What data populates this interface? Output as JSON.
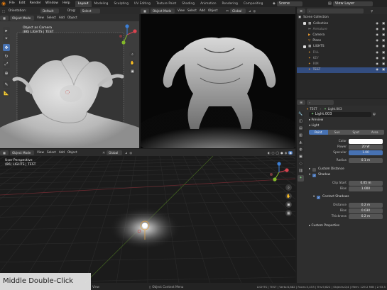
{
  "menubar": {
    "items": [
      "File",
      "Edit",
      "Render",
      "Window",
      "Help"
    ],
    "workspaces": [
      "Layout",
      "Modeling",
      "Sculpting",
      "UV Editing",
      "Texture Paint",
      "Shading",
      "Animation",
      "Rendering",
      "Compositing"
    ],
    "active_workspace": "Layout",
    "scene_label": "Scene",
    "view_layer_label": "View Layer"
  },
  "tool_header": {
    "orientation_label": "Orientation:",
    "orientation_value": "Default",
    "drag_label": "Drag:",
    "drag_value": "Select Box"
  },
  "viewport_top_left": {
    "mode": "Object Mode",
    "menus": [
      "View",
      "Select",
      "Add",
      "Object"
    ],
    "info_line1": "Object as Camera",
    "info_line2": "(86) LIGHTS | TEST"
  },
  "viewport_top_right": {
    "mode": "Object Mode",
    "menus": [
      "View",
      "Select",
      "Add",
      "Object"
    ],
    "transform": "Global"
  },
  "viewport_bottom": {
    "mode": "Object Mode",
    "menus": [
      "View",
      "Select",
      "Add",
      "Object"
    ],
    "transform": "Global",
    "info_line1": "User Perspective",
    "info_line2": "(86) LIGHTS | TEST"
  },
  "outliner": {
    "title": "Scene Collection",
    "rows": [
      {
        "label": "Collection",
        "indent": 1,
        "selected": false,
        "muted": false
      },
      {
        "label": "Armature",
        "indent": 2,
        "selected": false,
        "muted": true
      },
      {
        "label": "Camera",
        "indent": 2,
        "selected": false,
        "muted": false
      },
      {
        "label": "Plane",
        "indent": 2,
        "selected": false,
        "muted": false
      },
      {
        "label": "LIGHTS",
        "indent": 1,
        "selected": false,
        "muted": false
      },
      {
        "label": "FILL",
        "indent": 2,
        "selected": false,
        "muted": true
      },
      {
        "label": "KEY",
        "indent": 2,
        "selected": false,
        "muted": true
      },
      {
        "label": "RIM",
        "indent": 2,
        "selected": false,
        "muted": true
      },
      {
        "label": "TEST",
        "indent": 2,
        "selected": true,
        "muted": false
      }
    ]
  },
  "properties": {
    "breadcrumb_obj": "TEST",
    "breadcrumb_data": "Light.003",
    "datablock": "Light.003",
    "preview_label": "Preview",
    "light_label": "Light",
    "light_types": [
      "Point",
      "Sun",
      "Spot",
      "Area"
    ],
    "active_type": "Point",
    "fields": [
      {
        "key": "Color",
        "value": ""
      },
      {
        "key": "Power",
        "value": "20 W"
      },
      {
        "key": "Specular",
        "value": "1.00"
      },
      {
        "key": "Radius",
        "value": "0.1 m"
      }
    ],
    "custom_distance_label": "Custom Distance",
    "shadow_label": "Shadow",
    "shadow_fields": [
      {
        "key": "Clip Start",
        "value": "0.05 m"
      },
      {
        "key": "Bias",
        "value": "1.000"
      }
    ],
    "contact_label": "Contact Shadows",
    "contact_fields": [
      {
        "key": "Distance",
        "value": "0.2 m"
      },
      {
        "key": "Bias",
        "value": "0.030"
      },
      {
        "key": "Thickness",
        "value": "0.2 m"
      }
    ],
    "custom_properties_label": "Custom Properties"
  },
  "statusbar": {
    "left_hint": "View",
    "center_hint": "Object Context Menu",
    "stats": "LIGHTS | TEST | Verts:6,862 | Faces:5,453 | Tris:9,622 | Objects:0/4 | Mem: 129.2 MiB | 2.93.5"
  },
  "overlay_caption": "Middle Double-Click",
  "colors": {
    "accent": "#4772b3",
    "selection": "#334d80",
    "axis_red": "#d9434f",
    "axis_green": "#83b82a",
    "axis_blue": "#3c7fd6"
  }
}
